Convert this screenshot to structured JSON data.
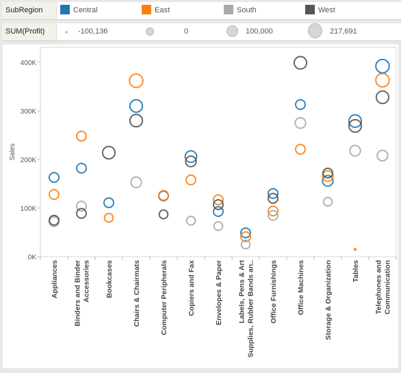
{
  "legend": {
    "color_title": "SubRegion",
    "color_items": [
      {
        "label": "Central",
        "color": "#1f77b4"
      },
      {
        "label": "East",
        "color": "#ff7f0e"
      },
      {
        "label": "South",
        "color": "#aaaaaa"
      },
      {
        "label": "West",
        "color": "#555555"
      }
    ],
    "size_title": "SUM(Profit)",
    "size_items": [
      {
        "label": "-100,136"
      },
      {
        "label": "0"
      },
      {
        "label": "100,000"
      },
      {
        "label": "217,691"
      }
    ]
  },
  "chart_data": {
    "type": "scatter",
    "title": "",
    "xlabel": "",
    "ylabel": "Sales",
    "ylim": [
      0,
      420000
    ],
    "yticks": [
      0,
      100000,
      200000,
      300000,
      400000
    ],
    "ytick_labels": [
      "0K",
      "100K",
      "200K",
      "300K",
      "400K"
    ],
    "grid": false,
    "legend": "top",
    "categories": [
      [
        "Appliances"
      ],
      [
        "Binders and Binder",
        "Accessories"
      ],
      [
        "Bookcases"
      ],
      [
        "Chairs & Chairmats"
      ],
      [
        "Computer Peripherals"
      ],
      [
        "Copiers and Fax"
      ],
      [
        "Envelopes & Paper"
      ],
      [
        "Labels, Pens & Art",
        "Supplies, Rubber Bands an.."
      ],
      [
        "Office Furnishings"
      ],
      [
        "Office Machines"
      ],
      [
        "Storage & Organization"
      ],
      [
        "Tables"
      ],
      [
        "Telephones and",
        "Communication"
      ]
    ],
    "series": [
      {
        "name": "Central",
        "color": "#1f77b4",
        "values": [
          163000,
          182000,
          111000,
          310000,
          125000,
          206000,
          93000,
          49000,
          130000,
          313000,
          156000,
          279000,
          392000
        ],
        "size": [
          1,
          1,
          1,
          1.3,
          1,
          1.2,
          1,
          1,
          1,
          1,
          1.1,
          1.3,
          1.4
        ]
      },
      {
        "name": "East",
        "color": "#ff7f0e",
        "values": [
          128000,
          248000,
          80000,
          362000,
          126000,
          158000,
          117000,
          41000,
          94000,
          221000,
          166000,
          15000,
          363000
        ],
        "size": [
          1,
          1,
          0.9,
          1.4,
          1,
          1,
          1,
          1,
          1,
          1,
          1.1,
          0.2,
          1.4
        ]
      },
      {
        "name": "South",
        "color": "#aaaaaa",
        "values": [
          72000,
          104000,
          null,
          153000,
          null,
          74000,
          63000,
          25000,
          85000,
          275000,
          113000,
          218000,
          208000
        ],
        "size": [
          1,
          1,
          0,
          1.1,
          0,
          0.9,
          0.9,
          0.9,
          1,
          1.1,
          0.9,
          1.1,
          1.1
        ]
      },
      {
        "name": "West",
        "color": "#555555",
        "values": [
          75000,
          89000,
          214000,
          280000,
          87000,
          196000,
          107000,
          null,
          120000,
          399000,
          172000,
          269000,
          328000
        ],
        "size": [
          1,
          1,
          1.3,
          1.3,
          0.9,
          1.1,
          1,
          0,
          1,
          1.3,
          1,
          1.3,
          1.3
        ]
      }
    ],
    "size_field": "SUM(Profit)"
  }
}
